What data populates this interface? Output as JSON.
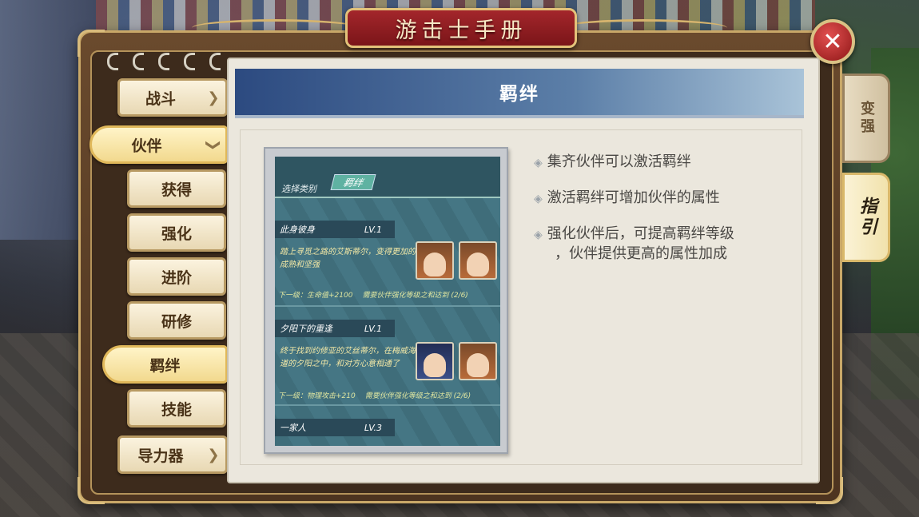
{
  "window": {
    "title": "游击士手册",
    "close_symbol": "✕"
  },
  "menu": {
    "items": [
      {
        "label": "战斗",
        "arrow": "❯",
        "type": "main"
      },
      {
        "label": "伙伴",
        "arrow": "❯",
        "type": "expanded"
      },
      {
        "label": "获得",
        "type": "sub"
      },
      {
        "label": "强化",
        "type": "sub"
      },
      {
        "label": "进阶",
        "type": "sub"
      },
      {
        "label": "研修",
        "type": "sub"
      },
      {
        "label": "羁绊",
        "type": "selected"
      },
      {
        "label": "技能",
        "type": "sub"
      },
      {
        "label": "导力器",
        "arrow": "❯",
        "type": "main"
      }
    ]
  },
  "side_tabs": [
    {
      "label": "变强",
      "active": false
    },
    {
      "label": "指引",
      "active": true
    }
  ],
  "page": {
    "header": "羁绊",
    "info": [
      {
        "lines": [
          "集齐伙伴可以激活羁绊"
        ]
      },
      {
        "lines": [
          "激活羁绊可增加伙伴的属性"
        ]
      },
      {
        "lines": [
          "强化伙伴后，可提高羁绊等级",
          "，伙伴提供更高的属性加成"
        ]
      }
    ],
    "bullet_icon": "◈"
  },
  "preview": {
    "select_label": "选择类别",
    "tab_label": "羁绊",
    "entries": [
      {
        "name": "此身彼身",
        "level": "LV.1",
        "desc": "踏上寻觅之路的艾斯蒂尔，变得更加的成熟和坚强",
        "next": "下一级：生命值+2100",
        "requirement": "需要伙伴强化等级之和达到 (2/6)",
        "avatars": [
          "brown",
          "brown"
        ]
      },
      {
        "name": "夕阳下的重逢",
        "level": "LV.1",
        "desc": "终于找到约修亚的艾丝蒂尔，在梅威海道的夕阳之中，和对方心意相通了",
        "next": "下一级：物理攻击+210",
        "requirement": "需要伙伴强化等级之和达到 (2/6)",
        "avatars": [
          "blue",
          "brown"
        ]
      },
      {
        "name": "一家人",
        "level": "LV.3"
      }
    ]
  }
}
